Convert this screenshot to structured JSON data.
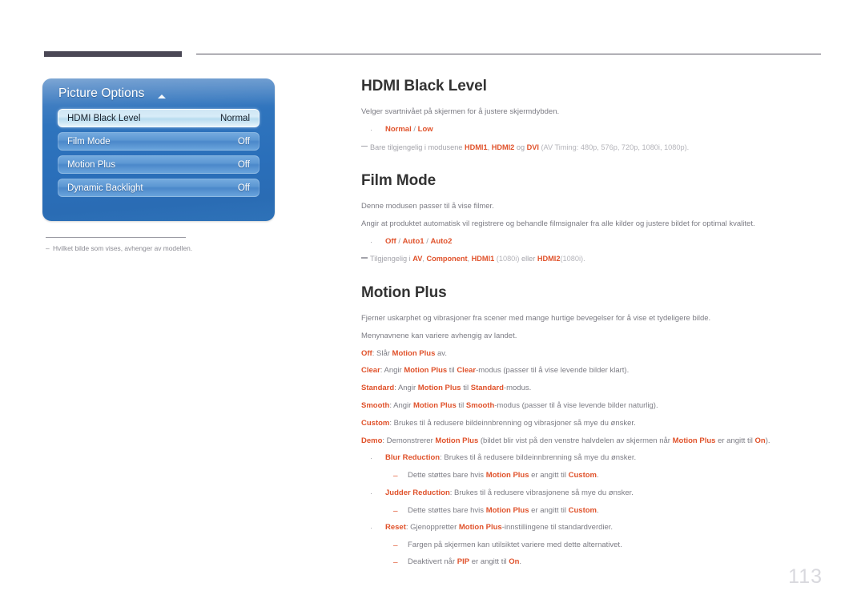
{
  "page": {
    "number": "113",
    "language": "no"
  },
  "header": {
    "rule_accent_color": "#4a4755",
    "rule_line_color": "#55525f"
  },
  "osd": {
    "title": "Picture Options",
    "caret_icon": "caret-up-icon",
    "panel_color": "#2f74bd",
    "rows": [
      {
        "label": "HDMI Black Level",
        "value": "Normal",
        "selected": true
      },
      {
        "label": "Film Mode",
        "value": "Off",
        "selected": false
      },
      {
        "label": "Motion Plus",
        "value": "Off",
        "selected": false
      },
      {
        "label": "Dynamic Backlight",
        "value": "Off",
        "selected": false
      }
    ],
    "footnote": {
      "marker": "–",
      "text": "Hvilket bilde som vises, avhenger av modellen."
    }
  },
  "accent_colors": {
    "orange": "#e0522b",
    "heading": "#333333",
    "body": "#7c7c84",
    "muted": "#a3a3aa"
  },
  "sections": [
    {
      "id": "hdmi-black-level",
      "title": "HDMI Black Level",
      "lines": {
        "description": "Velger svartnivået på skjermen for å justere skjermdybden.",
        "options_bullet": "Normal / Low",
        "note": "Bare tilgjengelig i modusene HDMI1, HDMI2 og DVI (AV Timing: 480p, 576p, 720p, 1080i, 1080p)."
      }
    },
    {
      "id": "film-mode",
      "title": "Film Mode",
      "lines": {
        "description1": "Denne modusen passer til å vise filmer.",
        "description2": "Angir at produktet automatisk vil registrere og behandle filmsignaler fra alle kilder og justere bildet for optimal kvalitet.",
        "options_bullet": "Off / Auto1 / Auto2",
        "note": "Tilgjengelig i AV, Component, HDMI1 (1080i) eller HDMI2(1080i)."
      }
    },
    {
      "id": "motion-plus",
      "title": "Motion Plus",
      "lines": {
        "description1": "Fjerner uskarphet og vibrasjoner fra scener med mange hurtige bevegelser for å vise et tydeligere bilde.",
        "description2": "Menynavnene kan variere avhengig av landet.",
        "def_off": "Off: Slår Motion Plus av.",
        "def_clear": "Clear: Angir Motion Plus til Clear-modus (passer til å vise levende bilder klart).",
        "def_standard": "Standard: Angir Motion Plus til Standard-modus.",
        "def_smooth": "Smooth: Angir Motion Plus til Smooth-modus (passer til å vise levende bilder naturlig).",
        "def_custom": "Custom: Brukes til å redusere bildeinnbrenning og vibrasjoner så mye du ønsker.",
        "def_demo": "Demo: Demonstrerer Motion Plus (bildet blir vist på den venstre halvdelen av skjermen når Motion Plus er angitt til On).",
        "bullet_blur": "Blur Reduction: Brukes til å redusere bildeinnbrenning så mye du ønsker.",
        "sub_blur": "Dette støttes bare hvis Motion Plus er angitt til Custom.",
        "bullet_judder": "Judder Reduction: Brukes til å redusere vibrasjonene så mye du ønsker.",
        "sub_judder": "Dette støttes bare hvis Motion Plus er angitt til Custom.",
        "bullet_reset": "Reset: Gjenoppretter Motion Plus-innstillingene til standardverdier.",
        "sub_reset1": "Fargen på skjermen kan utilsiktet variere med dette alternativet.",
        "sub_reset2": "Deaktivert når PIP er angitt til On."
      }
    }
  ],
  "markers": {
    "bullet": "·",
    "sub_dash": "–"
  }
}
